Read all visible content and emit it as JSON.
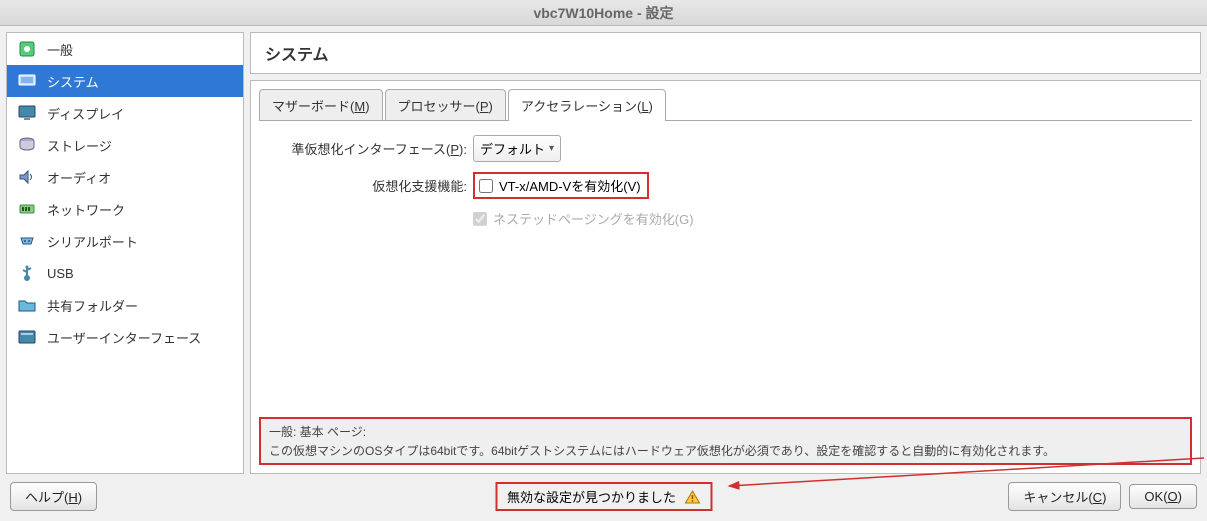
{
  "window": {
    "title": "vbc7W10Home - 設定"
  },
  "sidebar": {
    "items": [
      {
        "label": "一般"
      },
      {
        "label": "システム"
      },
      {
        "label": "ディスプレイ"
      },
      {
        "label": "ストレージ"
      },
      {
        "label": "オーディオ"
      },
      {
        "label": "ネットワーク"
      },
      {
        "label": "シリアルポート"
      },
      {
        "label": "USB"
      },
      {
        "label": "共有フォルダー"
      },
      {
        "label": "ユーザーインターフェース"
      }
    ]
  },
  "section": {
    "title": "システム"
  },
  "tabs": {
    "motherboard": {
      "text": "マザーボード(",
      "mnemonic": "M",
      "suffix": ")"
    },
    "processor": {
      "text": "プロセッサー(",
      "mnemonic": "P",
      "suffix": ")"
    },
    "accel": {
      "text": "アクセラレーション(",
      "mnemonic": "L",
      "suffix": ")"
    }
  },
  "fields": {
    "paravirt": {
      "label_pre": "準仮想化インターフェース(",
      "mnemonic": "P",
      "label_post": "):",
      "value": "デフォルト"
    },
    "hwvirt": {
      "label": "仮想化支援機能:",
      "vt": {
        "pre": "VT-x/AMD-Vを有効化(",
        "mnemonic": "V",
        "post": ")"
      },
      "nested": {
        "pre": "ネステッドページングを有効化(",
        "mnemonic": "G",
        "post": ")"
      }
    }
  },
  "info": {
    "header": "一般: 基本 ページ:",
    "body": "この仮想マシンのOSタイプは64bitです。64bitゲストシステムにはハードウェア仮想化が必須であり、設定を確認すると自動的に有効化されます。"
  },
  "status": {
    "text": "無効な設定が見つかりました"
  },
  "buttons": {
    "help": {
      "pre": "ヘルプ(",
      "mnemonic": "H",
      "post": ")"
    },
    "cancel": {
      "pre": "キャンセル(",
      "mnemonic": "C",
      "post": ")"
    },
    "ok": {
      "pre": "OK(",
      "mnemonic": "O",
      "post": ")"
    }
  }
}
